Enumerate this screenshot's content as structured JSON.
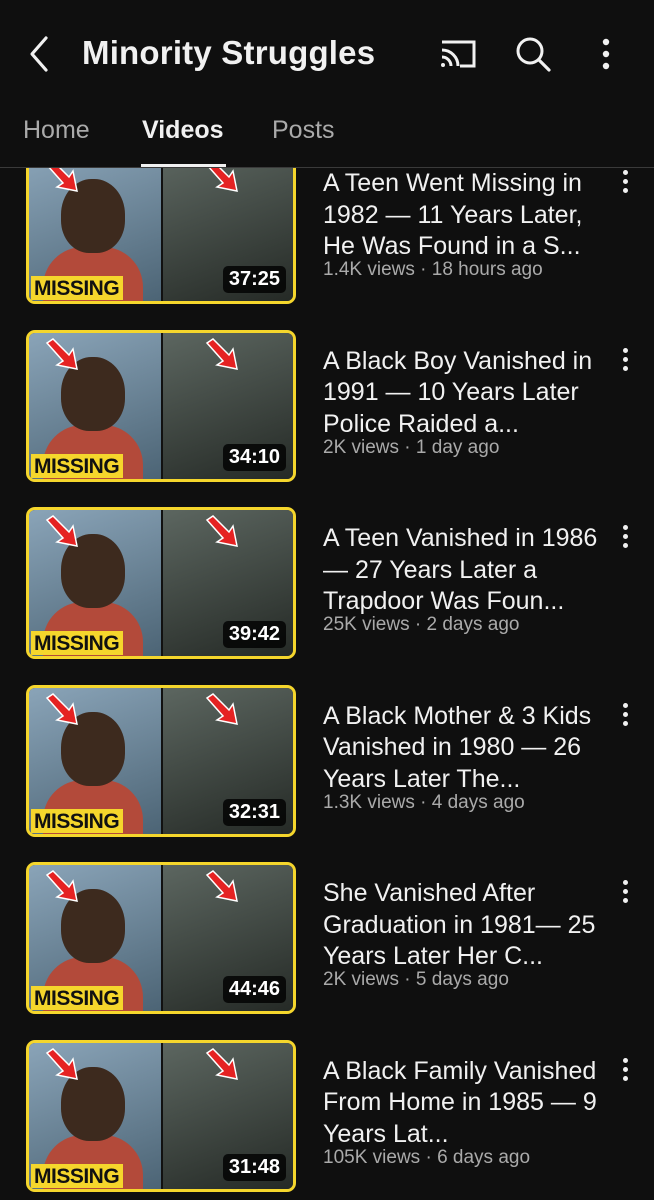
{
  "header": {
    "back_icon": "back-arrow-icon",
    "title": "Minority Struggles",
    "icons": [
      "cast-icon",
      "search-icon",
      "more-vertical-icon"
    ]
  },
  "tabs": [
    {
      "label": "Home",
      "active": false
    },
    {
      "label": "Videos",
      "active": true
    },
    {
      "label": "Posts",
      "active": false
    }
  ],
  "videos": [
    {
      "title": "A Teen Went Missing in 1982 — 11 Years Later, He Was Found in a S...",
      "views": "1.4K views",
      "age": "18 hours ago",
      "duration": "37:25",
      "badge": "MISSING"
    },
    {
      "title": "A Black Boy Vanished in 1991 — 10 Years Later Police Raided a...",
      "views": "2K views",
      "age": "1 day ago",
      "duration": "34:10",
      "badge": "MISSING"
    },
    {
      "title": "A Teen Vanished in 1986 — 27 Years Later a Trapdoor Was Foun...",
      "views": "25K views",
      "age": "2 days ago",
      "duration": "39:42",
      "badge": "MISSING"
    },
    {
      "title": "A Black Mother & 3 Kids Vanished in 1980 — 26 Years Later The...",
      "views": "1.3K views",
      "age": "4 days ago",
      "duration": "32:31",
      "badge": "MISSING"
    },
    {
      "title": "She Vanished After Graduation in 1981— 25 Years Later Her C...",
      "views": "2K views",
      "age": "5 days ago",
      "duration": "44:46",
      "badge": "MISSING"
    },
    {
      "title": "A Black Family Vanished From Home in 1985 — 9 Years Lat...",
      "views": "105K views",
      "age": "6 days ago",
      "duration": "31:48",
      "badge": "MISSING"
    }
  ],
  "colors": {
    "background": "#0f0f0f",
    "badge": "#f5d62c",
    "secondary_text": "#aaaaaa"
  }
}
